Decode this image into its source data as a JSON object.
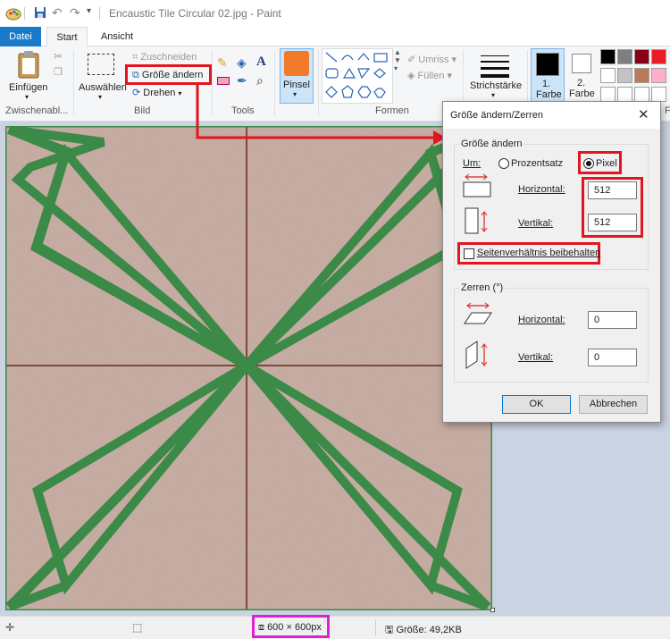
{
  "window": {
    "title": "Encaustic Tile Circular 02.jpg - Paint"
  },
  "tabs": {
    "datei": "Datei",
    "start": "Start",
    "ansicht": "Ansicht"
  },
  "ribbon": {
    "clipboard": {
      "paste": "Einfügen",
      "group": "Zwischenabl..."
    },
    "image": {
      "select": "Auswählen",
      "crop": "Zuschneiden",
      "resize": "Größe ändern",
      "rotate": "Drehen",
      "group": "Bild"
    },
    "tools": {
      "group": "Tools"
    },
    "brushes": {
      "label": "Pinsel"
    },
    "shapes": {
      "outline": "Umriss",
      "fill": "Füllen",
      "group": "Formen"
    },
    "stroke": {
      "label": "Strichstärke"
    },
    "colors": {
      "color1_line1": "1.",
      "color1_line2": "Farbe",
      "color2_line1": "2.",
      "color2_line2": "Farbe",
      "group": "F",
      "palette": [
        "#000000",
        "#7f7f7f",
        "#880015",
        "#ed1c24",
        "#ffffff",
        "#c3c3c3",
        "#b97a57",
        "#ffaec9",
        "#ffffff",
        "#ffffff",
        "#ffffff",
        "#ffffff"
      ]
    }
  },
  "dialog": {
    "title": "Größe ändern/Zerren",
    "resize_section": "Größe ändern",
    "by_label": "Um:",
    "percent_label": "Prozentsatz",
    "pixel_label": "Pixel",
    "horizontal_label": "Horizontal:",
    "vertical_label": "Vertikal:",
    "horizontal_value": "512",
    "vertical_value": "512",
    "aspect_label": "Seitenverhältnis beibehalten",
    "skew_section": "Zerren (°)",
    "skew_horizontal_label": "Horizontal:",
    "skew_vertical_label": "Vertikal:",
    "skew_horizontal_value": "0",
    "skew_vertical_value": "0",
    "ok": "OK",
    "cancel": "Abbrechen"
  },
  "statusbar": {
    "dimensions": "600 × 600px",
    "filesize": "Größe: 49,2KB"
  },
  "colors": {
    "accent": "#1979ca",
    "highlight_red": "#e2161f",
    "highlight_magenta": "#e020d0",
    "tile": "#c8aea4",
    "tile_green": "#3b8a47"
  }
}
